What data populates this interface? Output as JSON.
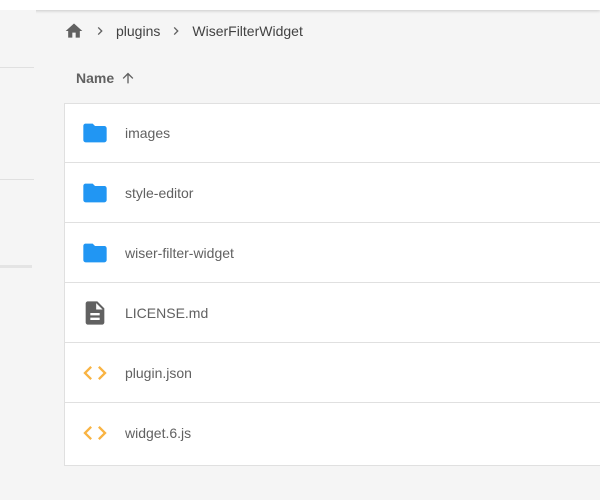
{
  "breadcrumb": {
    "home_icon": "home-icon",
    "separator_icon": "chevron-right-icon",
    "items": [
      "plugins",
      "WiserFilterWidget"
    ]
  },
  "table": {
    "column_name": "Name",
    "sort_icon": "arrow-up-icon",
    "sort_direction": "ascending"
  },
  "files": [
    {
      "name": "images",
      "type": "folder",
      "icon": "folder-icon"
    },
    {
      "name": "style-editor",
      "type": "folder",
      "icon": "folder-icon"
    },
    {
      "name": "wiser-filter-widget",
      "type": "folder",
      "icon": "folder-icon"
    },
    {
      "name": "LICENSE.md",
      "type": "file",
      "icon": "document-icon"
    },
    {
      "name": "plugin.json",
      "type": "code",
      "icon": "code-icon"
    },
    {
      "name": "widget.6.js",
      "type": "code",
      "icon": "code-icon"
    }
  ],
  "colors": {
    "folder": "#2196f3",
    "document": "#616161",
    "code": "#f9b342",
    "text": "#616161",
    "border": "#e0e0e0"
  }
}
